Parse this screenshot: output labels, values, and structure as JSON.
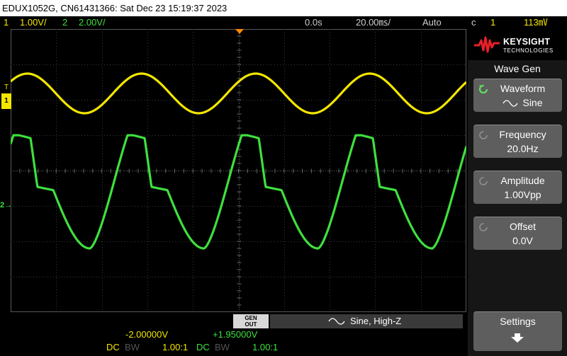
{
  "title": "EDUX1052G, CN61431366: Sat Dec 23 15:19:37 2023",
  "status": {
    "ch1_num": "1",
    "ch1_scale": "1.00V/",
    "ch2_num": "2",
    "ch2_scale": "2.00V/",
    "time_offset": "0.0s",
    "time_scale": "20.00㎳/",
    "trigger_mode": "Auto",
    "trigger_source": "1",
    "trigger_level": "113㎷"
  },
  "markers": {
    "ch1": "1",
    "ch2": "2",
    "trig": "T"
  },
  "bottom": {
    "gen_out_line1": "GEN",
    "gen_out_line2": "OUT",
    "wave_status": "Sine, High-Z",
    "ch1_offset": "-2.00000V",
    "ch2_offset": "+1.95000V",
    "ch1_coupling": "DC",
    "ch1_bw": "BW",
    "ch1_probe": "1.00:1",
    "ch2_coupling": "DC",
    "ch2_bw": "BW",
    "ch2_probe": "1.00:1"
  },
  "panel": {
    "brand": "KEYSIGHT",
    "brand_sub": "TECHNOLOGIES",
    "menu_title": "Wave Gen",
    "softkeys": [
      {
        "label": "Waveform",
        "value": "Sine"
      },
      {
        "label": "Frequency",
        "value": "20.0Hz"
      },
      {
        "label": "Amplitude",
        "value": "1.00Vpp"
      },
      {
        "label": "Offset",
        "value": "0.0V"
      }
    ],
    "settings_label": "Settings"
  },
  "colors": {
    "ch1": "#f2e600",
    "ch2": "#3ee03e",
    "trigger": "#ff8a00"
  }
}
